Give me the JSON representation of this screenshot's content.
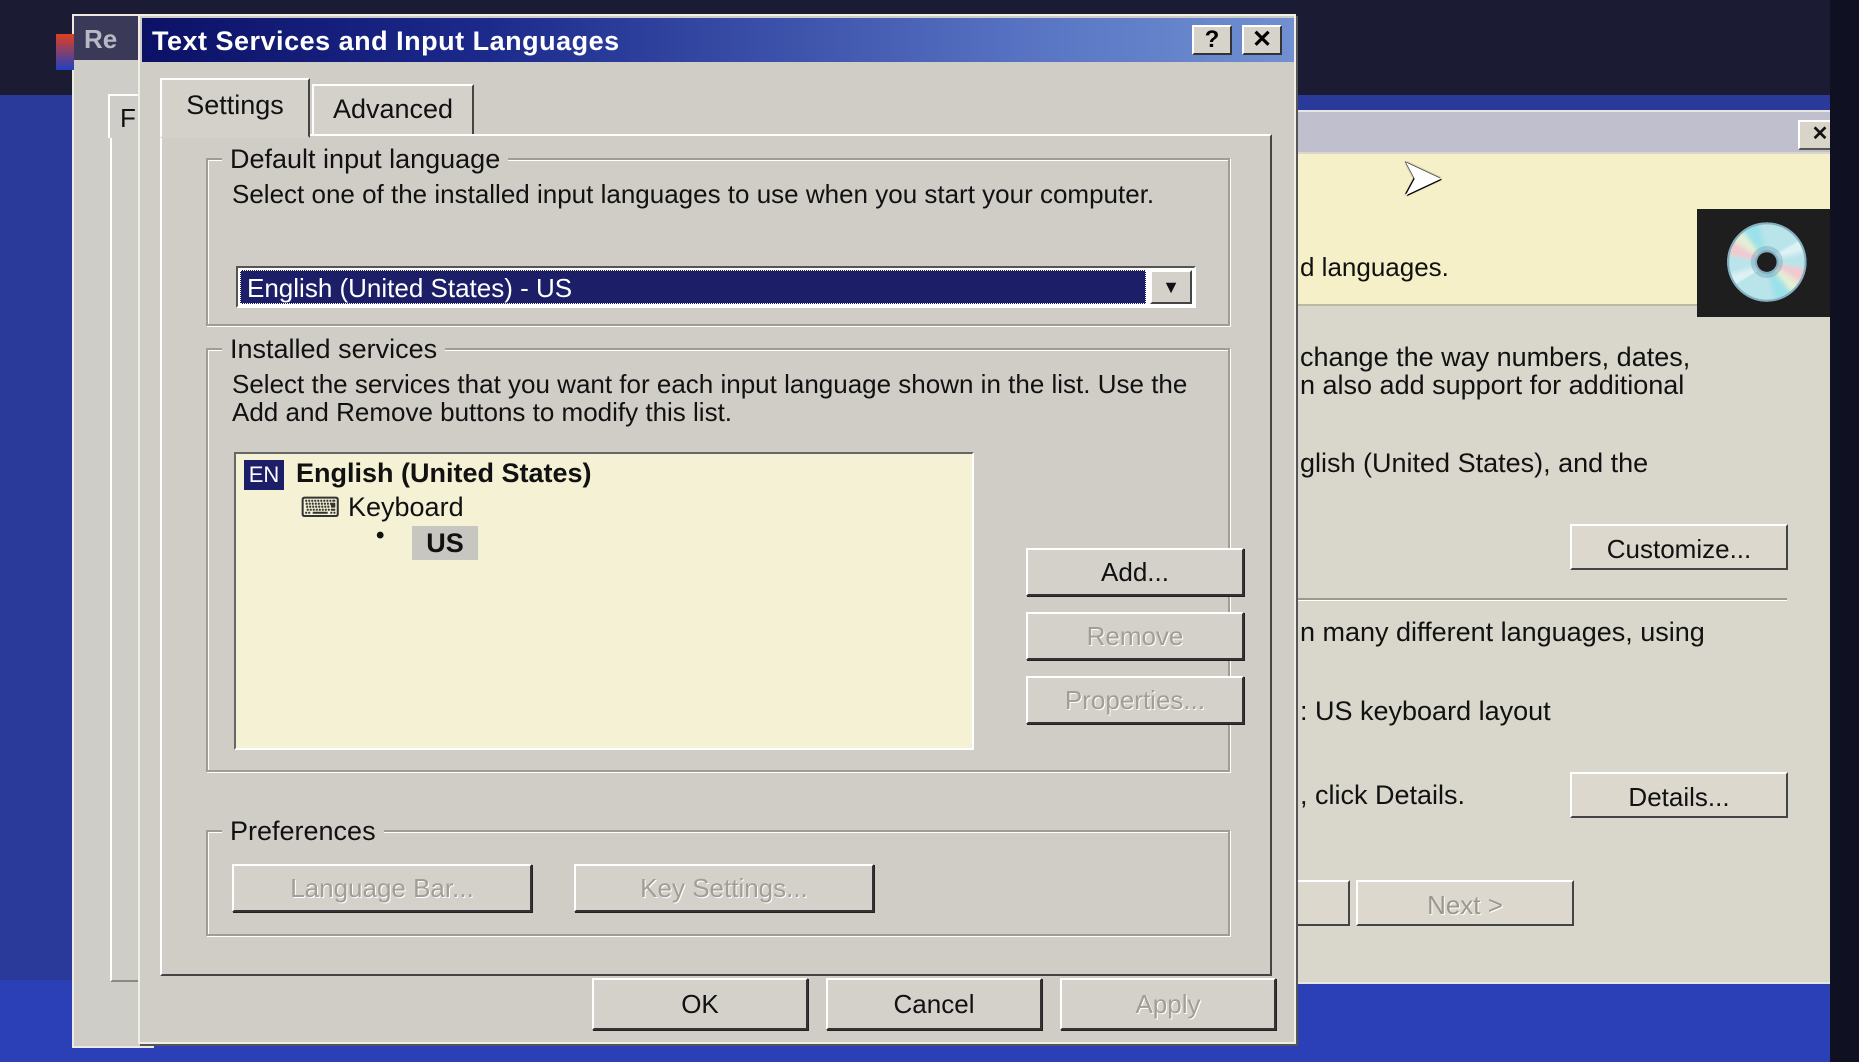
{
  "back_dialog": {
    "title_fragment": "Re",
    "tab_fragment": "F"
  },
  "dialog": {
    "title": "Text Services and Input Languages",
    "help_glyph": "?",
    "close_glyph": "✕",
    "tabs": [
      "Settings",
      "Advanced"
    ],
    "default_group": {
      "label": "Default input language",
      "description": "Select one of the installed input languages to use when you start your computer.",
      "selected": "English (United States) - US",
      "arrow_glyph": "▼"
    },
    "services_group": {
      "label": "Installed services",
      "description": "Select the services that you want for each input language shown in the list. Use the Add and Remove buttons to modify this list.",
      "tree": {
        "tag": "EN",
        "language": "English (United States)",
        "category": "Keyboard",
        "layout_bullet": "•",
        "layout": "US"
      },
      "buttons": {
        "add": "Add...",
        "remove": "Remove",
        "properties": "Properties..."
      }
    },
    "preferences_group": {
      "label": "Preferences",
      "language_bar": "Language Bar...",
      "key_settings": "Key Settings..."
    },
    "footer": {
      "ok": "OK",
      "cancel": "Cancel",
      "apply": "Apply"
    }
  },
  "background_window": {
    "close_glyph": "✕",
    "banner_text": "d languages.",
    "icon": "cd-icon",
    "lines": [
      "change the way numbers, dates,",
      "n also add support for additional",
      "glish (United States), and the",
      "n many different languages, using",
      ": US keyboard layout",
      ", click Details."
    ],
    "customize": "Customize...",
    "details": "Details...",
    "next": "Next >"
  }
}
